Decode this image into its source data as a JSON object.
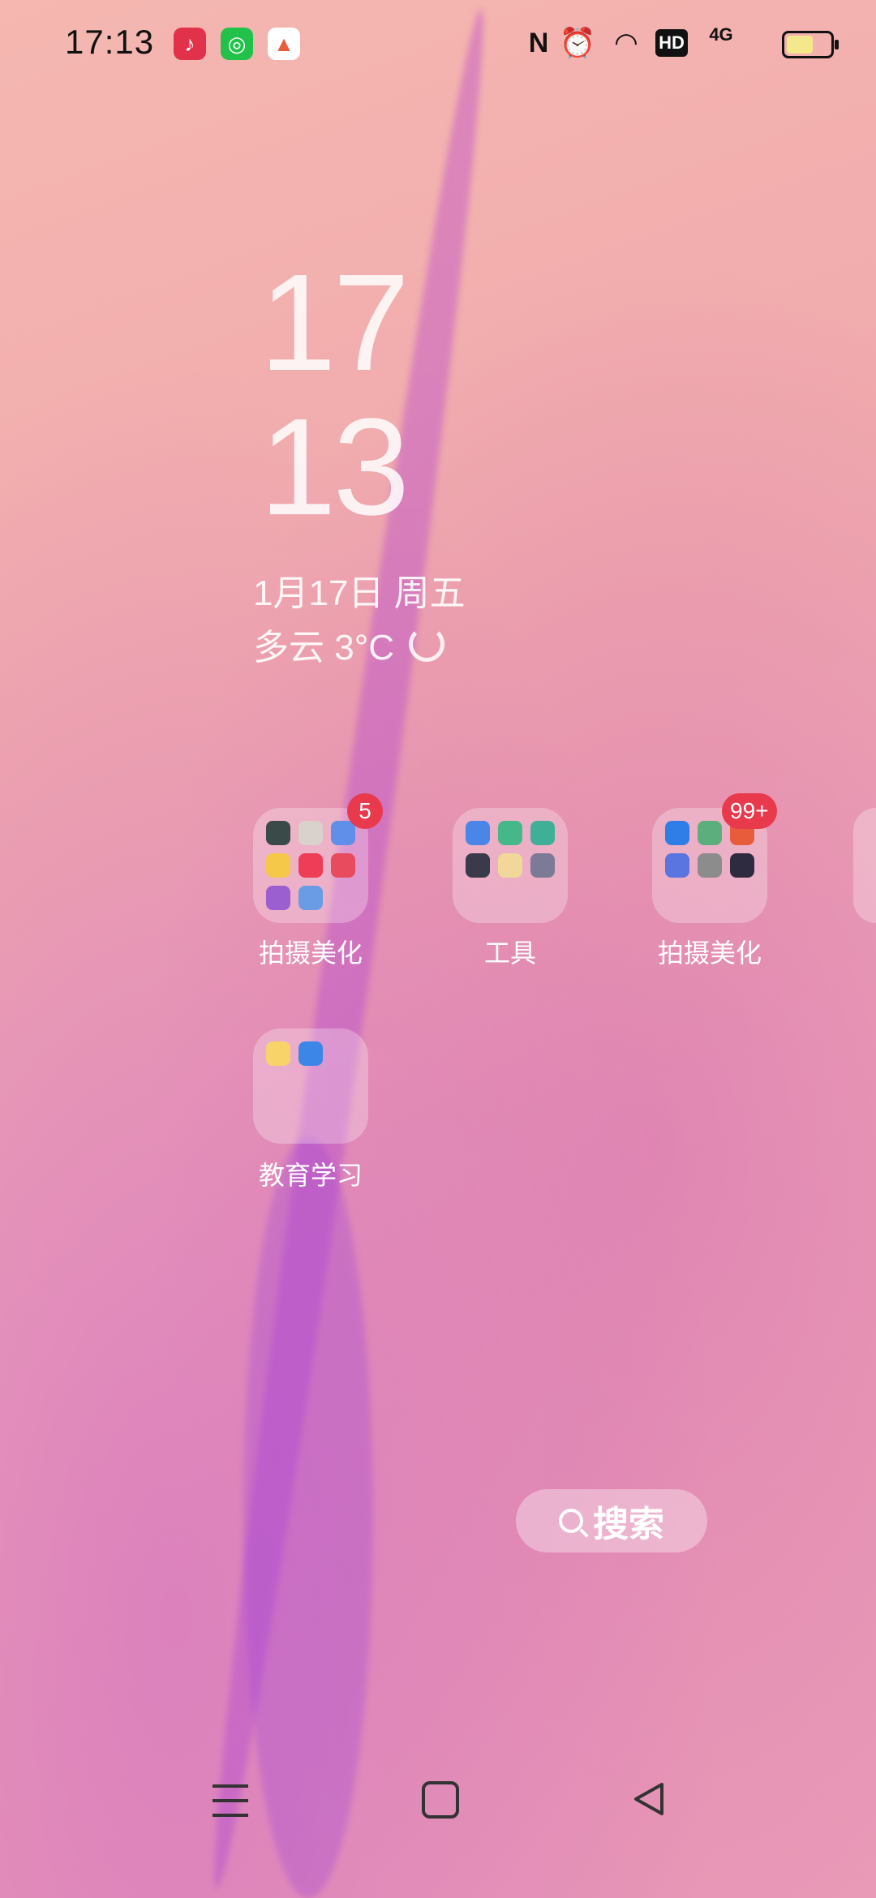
{
  "status_bar": {
    "time": "17:13",
    "notification_icons": [
      "music-icon",
      "green-ring-icon",
      "photo-app-icon"
    ],
    "system_icons": [
      "nfc-icon",
      "alarm-icon",
      "wifi-icon",
      "hd-icon",
      "4g-signal-icon",
      "battery-icon"
    ],
    "hd_label": "HD",
    "net_label": "4G"
  },
  "clock_widget": {
    "hour": "17",
    "minute": "13",
    "date": "1月17日 周五",
    "weather": "多云 3°C"
  },
  "folders": [
    {
      "label": "拍摄美化",
      "badge": "5"
    },
    {
      "label": "工具",
      "badge": ""
    },
    {
      "label": "拍摄美化",
      "badge": "99+"
    },
    {
      "label": "教育学习",
      "badge": ""
    }
  ],
  "search": {
    "label": "搜索"
  },
  "colors": {
    "badge": "#e8394d",
    "wallpaper_pink": "#f0a9ad",
    "wallpaper_purple": "#b24bd1"
  }
}
